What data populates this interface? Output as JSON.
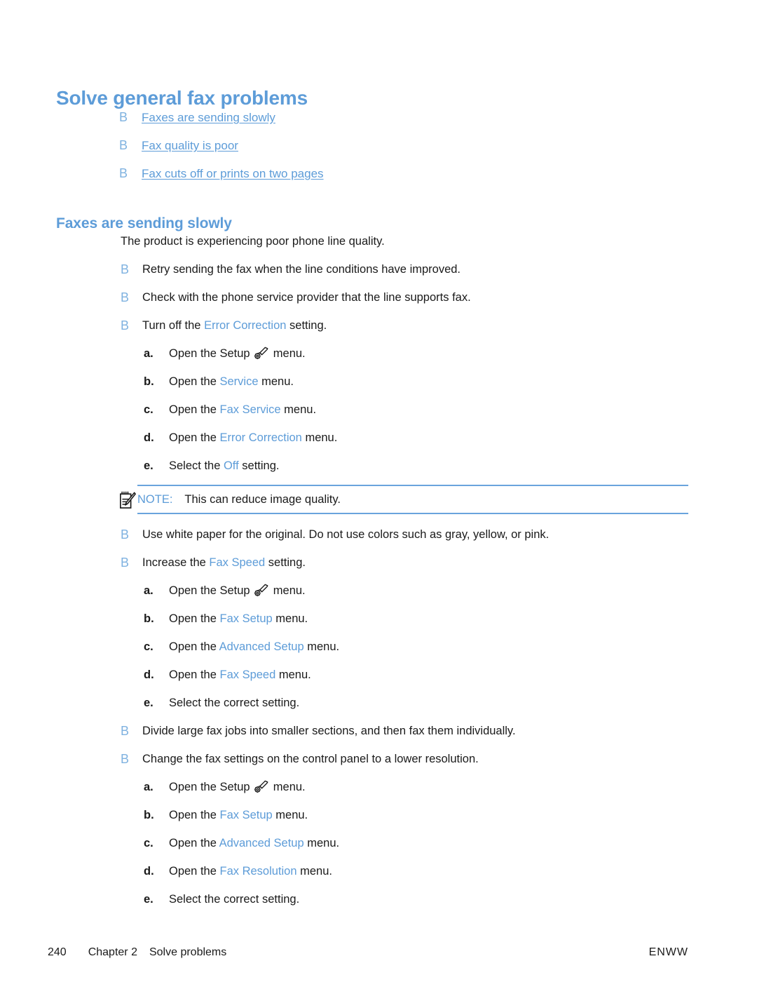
{
  "colors": {
    "accent_blue": "#5d9cd8",
    "bullet_blue": "#7fb2e0",
    "rule_blue": "#6aa4dd",
    "body_text": "#1a1a1a",
    "page_background": "#ffffff"
  },
  "title": "Solve general fax problems",
  "toc": {
    "bullet_glyph": "B",
    "links": [
      {
        "label": "Faxes are sending slowly"
      },
      {
        "label": "Fax quality is poor"
      },
      {
        "label": "Fax cuts off or prints on two pages"
      }
    ]
  },
  "section": {
    "heading": "Faxes are sending slowly",
    "intro": "The product is experiencing poor phone line quality."
  },
  "bullet_glyph": "B",
  "bullets": [
    {
      "id": "retry-sending",
      "segments": [
        {
          "text": "Retry sending the fax when the line conditions have improved.",
          "style": "plain"
        }
      ],
      "steps": []
    },
    {
      "id": "check-provider",
      "segments": [
        {
          "text": "Check with the phone service provider that the line supports fax.",
          "style": "plain"
        }
      ],
      "steps": []
    },
    {
      "id": "turn-off-error-correction",
      "segments": [
        {
          "text": "Turn off the ",
          "style": "plain"
        },
        {
          "text": "Error Correction",
          "style": "ui"
        },
        {
          "text": " setting.",
          "style": "plain"
        }
      ],
      "steps": [
        {
          "marker": "a.",
          "segments": [
            {
              "text": "Open the Setup ",
              "style": "plain"
            },
            {
              "text": "",
              "style": "icon",
              "icon": "setup-wrench-gear-icon"
            },
            {
              "text": " menu.",
              "style": "plain"
            }
          ]
        },
        {
          "marker": "b.",
          "segments": [
            {
              "text": "Open the ",
              "style": "plain"
            },
            {
              "text": "Service",
              "style": "ui"
            },
            {
              "text": " menu.",
              "style": "plain"
            }
          ]
        },
        {
          "marker": "c.",
          "segments": [
            {
              "text": "Open the ",
              "style": "plain"
            },
            {
              "text": "Fax Service",
              "style": "ui"
            },
            {
              "text": " menu.",
              "style": "plain"
            }
          ]
        },
        {
          "marker": "d.",
          "segments": [
            {
              "text": "Open the ",
              "style": "plain"
            },
            {
              "text": "Error Correction",
              "style": "ui"
            },
            {
              "text": " menu.",
              "style": "plain"
            }
          ]
        },
        {
          "marker": "e.",
          "segments": [
            {
              "text": "Select the ",
              "style": "plain"
            },
            {
              "text": "Off",
              "style": "ui"
            },
            {
              "text": " setting.",
              "style": "plain"
            }
          ]
        }
      ],
      "note": {
        "label": "NOTE:",
        "text": "This can reduce image quality.",
        "icon": "note-clipboard-pencil-icon"
      }
    },
    {
      "id": "use-white-paper",
      "segments": [
        {
          "text": "Use white paper for the original. Do not use colors such as gray, yellow, or pink.",
          "style": "plain"
        }
      ],
      "steps": []
    },
    {
      "id": "increase-fax-speed",
      "segments": [
        {
          "text": "Increase the ",
          "style": "plain"
        },
        {
          "text": "Fax Speed",
          "style": "ui"
        },
        {
          "text": " setting.",
          "style": "plain"
        }
      ],
      "steps": [
        {
          "marker": "a.",
          "segments": [
            {
              "text": "Open the Setup ",
              "style": "plain"
            },
            {
              "text": "",
              "style": "icon",
              "icon": "setup-wrench-gear-icon"
            },
            {
              "text": " menu.",
              "style": "plain"
            }
          ]
        },
        {
          "marker": "b.",
          "segments": [
            {
              "text": "Open the ",
              "style": "plain"
            },
            {
              "text": "Fax Setup",
              "style": "ui"
            },
            {
              "text": " menu.",
              "style": "plain"
            }
          ]
        },
        {
          "marker": "c.",
          "segments": [
            {
              "text": "Open the ",
              "style": "plain"
            },
            {
              "text": "Advanced Setup",
              "style": "ui"
            },
            {
              "text": " menu.",
              "style": "plain"
            }
          ]
        },
        {
          "marker": "d.",
          "segments": [
            {
              "text": "Open the ",
              "style": "plain"
            },
            {
              "text": "Fax Speed",
              "style": "ui"
            },
            {
              "text": " menu.",
              "style": "plain"
            }
          ]
        },
        {
          "marker": "e.",
          "segments": [
            {
              "text": "Select the correct setting.",
              "style": "plain"
            }
          ]
        }
      ]
    },
    {
      "id": "divide-large-jobs",
      "segments": [
        {
          "text": "Divide large fax jobs into smaller sections, and then fax them individually.",
          "style": "plain"
        }
      ],
      "steps": []
    },
    {
      "id": "lower-resolution",
      "segments": [
        {
          "text": "Change the fax settings on the control panel to a lower resolution.",
          "style": "plain"
        }
      ],
      "steps": [
        {
          "marker": "a.",
          "segments": [
            {
              "text": "Open the Setup ",
              "style": "plain"
            },
            {
              "text": "",
              "style": "icon",
              "icon": "setup-wrench-gear-icon"
            },
            {
              "text": " menu.",
              "style": "plain"
            }
          ]
        },
        {
          "marker": "b.",
          "segments": [
            {
              "text": "Open the ",
              "style": "plain"
            },
            {
              "text": "Fax Setup",
              "style": "ui"
            },
            {
              "text": " menu.",
              "style": "plain"
            }
          ]
        },
        {
          "marker": "c.",
          "segments": [
            {
              "text": "Open the ",
              "style": "plain"
            },
            {
              "text": "Advanced Setup",
              "style": "ui"
            },
            {
              "text": " menu.",
              "style": "plain"
            }
          ]
        },
        {
          "marker": "d.",
          "segments": [
            {
              "text": "Open the ",
              "style": "plain"
            },
            {
              "text": "Fax Resolution",
              "style": "ui"
            },
            {
              "text": " menu.",
              "style": "plain"
            }
          ]
        },
        {
          "marker": "e.",
          "segments": [
            {
              "text": "Select the correct setting.",
              "style": "plain"
            }
          ]
        }
      ]
    }
  ],
  "footer": {
    "page_number": "240",
    "chapter": "Chapter 2",
    "chapter_title": "Solve problems",
    "locale": "ENWW"
  }
}
